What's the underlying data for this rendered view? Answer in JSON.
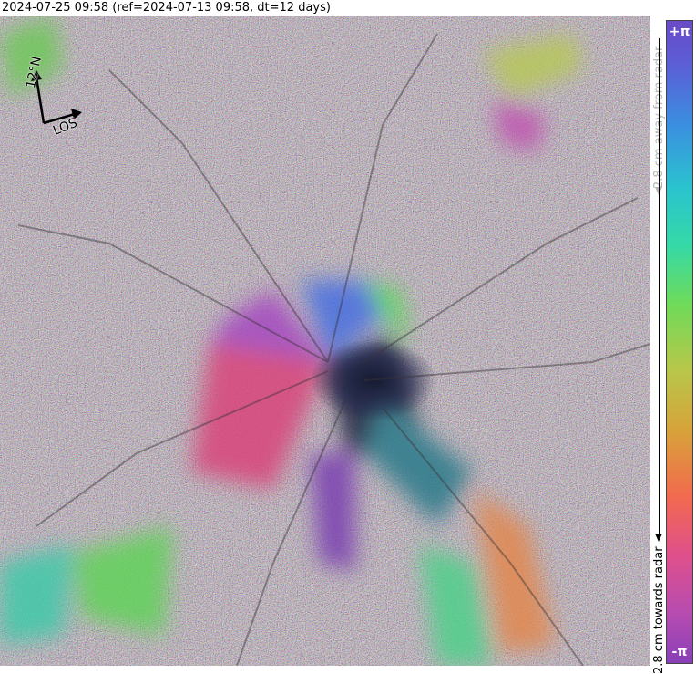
{
  "header": {
    "title": "2024-07-25 09:58 (ref=2024-07-13 09:58, dt=12 days)"
  },
  "compass": {
    "north_label": "12°N",
    "los_label": "LOS"
  },
  "colorbar": {
    "top_symbol": "+π",
    "bottom_symbol": "-π",
    "top_label": "2.8 cm away from radar",
    "bottom_label": "2.8 cm towards radar",
    "colors": [
      "#8a3fb8",
      "#e0508a",
      "#f26a4e",
      "#d8a23a",
      "#6edb5a",
      "#2ac3cf",
      "#3b8ee0",
      "#6a4ac8"
    ]
  }
}
